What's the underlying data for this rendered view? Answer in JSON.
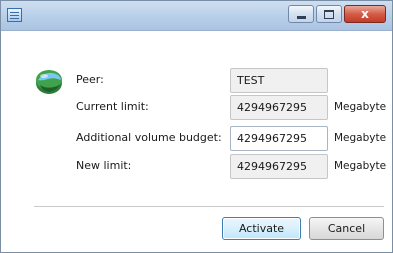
{
  "window": {
    "title": "",
    "controls": {
      "minimize": "",
      "maximize": "",
      "close": "x"
    }
  },
  "form": {
    "peer": {
      "label": "Peer:",
      "value": "TEST"
    },
    "current_limit": {
      "label": "Current limit:",
      "value": "4294967295",
      "unit": "Megabyte"
    },
    "additional_budget": {
      "label": "Additional volume budget:",
      "value": "4294967295",
      "unit": "Megabyte"
    },
    "new_limit": {
      "label": "New limit:",
      "value": "4294967295",
      "unit": "Megabyte"
    }
  },
  "buttons": {
    "activate": "Activate",
    "cancel": "Cancel"
  },
  "icons": {
    "app": "app-window-icon",
    "peer": "peer-globe-icon"
  },
  "colors": {
    "accent": "#3c7fb1",
    "close": "#c23c28",
    "title_bar": "#b9d0ea"
  }
}
